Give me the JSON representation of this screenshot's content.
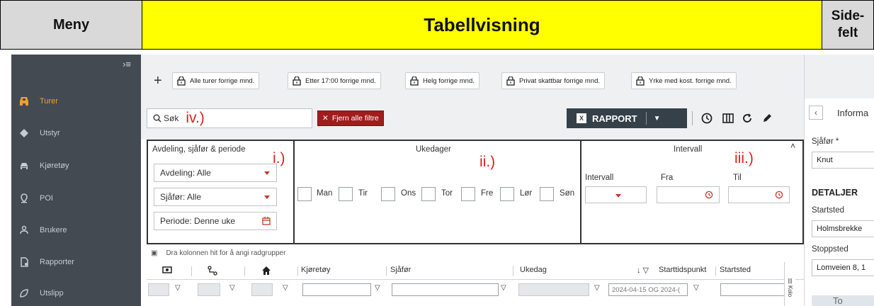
{
  "header": {
    "menu": "Meny",
    "table_view": "Tabellvisning",
    "side_panel": "Side-\nfelt"
  },
  "sidebar": {
    "items": [
      {
        "label": "Turer",
        "icon": "car-front-icon",
        "active": true
      },
      {
        "label": "Utstyr",
        "icon": "diamond-icon"
      },
      {
        "label": "Kjøretøy",
        "icon": "car-icon"
      },
      {
        "label": "POI",
        "icon": "location-pin-icon"
      },
      {
        "label": "Brukere",
        "icon": "user-icon"
      },
      {
        "label": "Rapporter",
        "icon": "report-file-icon"
      },
      {
        "label": "Utslipp",
        "icon": "leaf-icon"
      }
    ]
  },
  "saved_filters": [
    "Alle turer forrige mnd.",
    "Etter 17:00 forrige mnd.",
    "Helg forrige mnd.",
    "Privat skattbar forrige mnd.",
    "Yrke med kost. forrige mnd."
  ],
  "toolbar": {
    "search_placeholder": "Søk",
    "search_annotation": "iv.)",
    "clear_filters": "Fjern alle filtre",
    "report": "RAPPORT"
  },
  "filter_panel": {
    "section1": {
      "title": "Avdeling, sjåfør & periode",
      "annotation": "i.)",
      "department": "Avdeling: Alle",
      "driver": "Sjåfør: Alle",
      "period": "Periode: Denne uke"
    },
    "section2": {
      "title": "Ukedager",
      "annotation": "ii.)",
      "days": [
        "Man",
        "Tir",
        "Ons",
        "Tor",
        "Fre",
        "Lør",
        "Søn"
      ]
    },
    "section3": {
      "title": "Intervall",
      "annotation": "iii.)",
      "interval_label": "Intervall",
      "from_label": "Fra",
      "to_label": "Til"
    }
  },
  "grid": {
    "group_hint": "Dra kolonnen hit for å angi radgrupper",
    "columns": [
      "Kjøretøy",
      "Sjåfør",
      "Ukedag",
      "Starttidspunkt",
      "Startsted"
    ],
    "start_time_filter": "2024-04-15 OG 2024-(",
    "column_menu_label": "Kolo"
  },
  "side_panel": {
    "title": "Informa",
    "driver_label": "Sjåfør *",
    "driver_value": "Knut",
    "details_heading": "DETALJER",
    "start_label": "Startsted",
    "start_value": "Holmsbrekke",
    "stop_label": "Stoppsted",
    "stop_value": "Lomveien 8, 1",
    "map_text": "To"
  }
}
